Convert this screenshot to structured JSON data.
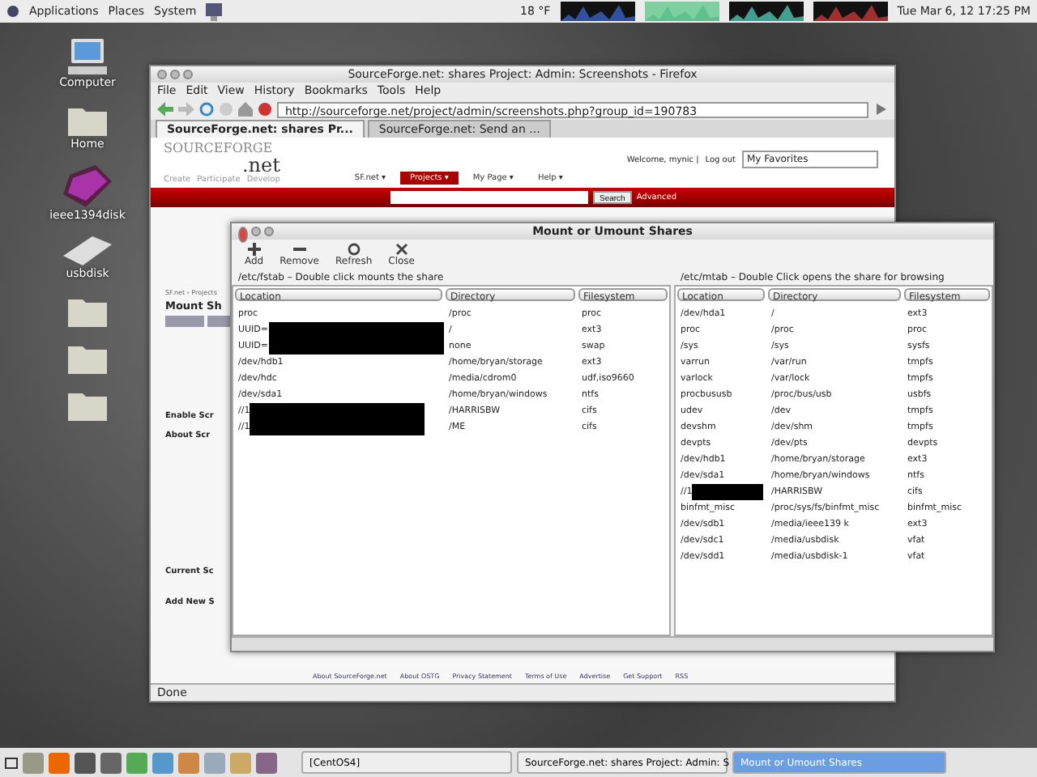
{
  "top_panel": {
    "menus": [
      "Applications",
      "Places",
      "System"
    ],
    "weather": "18 °F",
    "clock": "Tue Mar 6, 12 17:25 PM"
  },
  "desktop_icons": [
    {
      "label": "Computer",
      "kind": "computer"
    },
    {
      "label": "Home",
      "kind": "folder"
    },
    {
      "label": "ieee1394disk",
      "kind": "disk"
    },
    {
      "label": "usbdisk",
      "kind": "drive"
    },
    {
      "kind": "folder"
    },
    {
      "kind": "folder"
    },
    {
      "kind": "folder"
    }
  ],
  "browser": {
    "title": "SourceForge.net: shares Project: Admin: Screenshots - Firefox",
    "menus": [
      "File",
      "Edit",
      "View",
      "History",
      "Bookmarks",
      "Tools",
      "Help"
    ],
    "url": "http://sourceforge.net/project/admin/screenshots.php?group_id=190783",
    "tabs": [
      {
        "label": "SourceForge.net: shares Pr...",
        "selected": true
      },
      {
        "label": "SourceForge.net: Send an ...",
        "selected": false
      }
    ],
    "page": {
      "logo_top": "SOURCEFORGE",
      "logo_bottom": ".net",
      "sublinks": [
        "Create",
        "Participate",
        "Develop"
      ],
      "welcome": "Welcome, mynic |",
      "logout": "Log out",
      "favorites": "My Favorites",
      "nav": [
        {
          "label": "SF.net ▾",
          "selected": false
        },
        {
          "label": "Projects ▾",
          "selected": true
        },
        {
          "label": "My Page ▾",
          "selected": false
        },
        {
          "label": "Help ▾",
          "selected": false
        }
      ],
      "search_button": "Search",
      "advanced": "Advanced",
      "breadcrumb": "SF.net › Projects",
      "heading": "Mount Sh",
      "sections": [
        {
          "label": "Enable Scr"
        },
        {
          "label": "About Scr"
        },
        {
          "label": "Current Sc"
        },
        {
          "label": "Add New S"
        }
      ],
      "footer": [
        "About SourceForge.net",
        "About OSTG",
        "Privacy Statement",
        "Terms of Use",
        "Advertise",
        "Get Support",
        "RSS"
      ]
    },
    "status": "Done"
  },
  "dialog": {
    "title": "Mount or Umount Shares",
    "toolbar": [
      {
        "label": "Add",
        "kind": "add"
      },
      {
        "label": "Remove",
        "kind": "remove"
      },
      {
        "label": "Refresh",
        "kind": "refresh"
      },
      {
        "label": "Close",
        "kind": "close"
      }
    ],
    "panes": [
      {
        "caption": "/etc/fstab – Double click mounts the share",
        "columns": [
          "Location",
          "Directory",
          "Filesystem"
        ],
        "rows": [
          {
            "location": "proc",
            "redacted": false,
            "directory": "/proc",
            "filesystem": "proc"
          },
          {
            "location": "UUID=",
            "redacted": true,
            "directory": "/",
            "filesystem": "ext3"
          },
          {
            "location": "UUID=",
            "redacted": true,
            "directory": "none",
            "filesystem": "swap"
          },
          {
            "location": "/dev/hdb1",
            "redacted": false,
            "directory": "/home/bryan/storage",
            "filesystem": "ext3"
          },
          {
            "location": "/dev/hdc",
            "redacted": false,
            "directory": "/media/cdrom0",
            "filesystem": "udf,iso9660"
          },
          {
            "location": "/dev/sda1",
            "redacted": false,
            "directory": "/home/bryan/windows",
            "filesystem": "ntfs"
          },
          {
            "location": "//1",
            "redacted": true,
            "directory": "/HARRISBW",
            "filesystem": "cifs"
          },
          {
            "location": "//1",
            "redacted": true,
            "directory": "/ME",
            "filesystem": "cifs"
          }
        ]
      },
      {
        "caption": "/etc/mtab – Double Click opens the share for browsing",
        "columns": [
          "Location",
          "Directory",
          "Filesystem"
        ],
        "rows": [
          {
            "location": "/dev/hda1",
            "redacted": false,
            "directory": "/",
            "filesystem": "ext3"
          },
          {
            "location": "proc",
            "redacted": false,
            "directory": "/proc",
            "filesystem": "proc"
          },
          {
            "location": "/sys",
            "redacted": false,
            "directory": "/sys",
            "filesystem": "sysfs"
          },
          {
            "location": "varrun",
            "redacted": false,
            "directory": "/var/run",
            "filesystem": "tmpfs"
          },
          {
            "location": "varlock",
            "redacted": false,
            "directory": "/var/lock",
            "filesystem": "tmpfs"
          },
          {
            "location": "procbususb",
            "redacted": false,
            "directory": "/proc/bus/usb",
            "filesystem": "usbfs"
          },
          {
            "location": "udev",
            "redacted": false,
            "directory": "/dev",
            "filesystem": "tmpfs"
          },
          {
            "location": "devshm",
            "redacted": false,
            "directory": "/dev/shm",
            "filesystem": "tmpfs"
          },
          {
            "location": "devpts",
            "redacted": false,
            "directory": "/dev/pts",
            "filesystem": "devpts"
          },
          {
            "location": "/dev/hdb1",
            "redacted": false,
            "directory": "/home/bryan/storage",
            "filesystem": "ext3"
          },
          {
            "location": "/dev/sda1",
            "redacted": false,
            "directory": "/home/bryan/windows",
            "filesystem": "ntfs"
          },
          {
            "location": "//1",
            "redacted": true,
            "directory": "/HARRISBW",
            "filesystem": "cifs"
          },
          {
            "location": "binfmt_misc",
            "redacted": false,
            "directory": "/proc/sys/fs/binfmt_misc",
            "filesystem": "binfmt_misc"
          },
          {
            "location": "/dev/sdb1",
            "redacted": false,
            "directory": "/media/ieee139 k",
            "filesystem": "ext3"
          },
          {
            "location": "/dev/sdc1",
            "redacted": false,
            "directory": "/media/usbdisk",
            "filesystem": "vfat"
          },
          {
            "location": "/dev/sdd1",
            "redacted": false,
            "directory": "/media/usbdisk-1",
            "filesystem": "vfat"
          }
        ]
      }
    ]
  },
  "taskbar": {
    "tasks": [
      {
        "label": "[CentOS4]",
        "selected": false
      },
      {
        "label": "SourceForge.net: shares Project: Admin: S",
        "selected": false
      },
      {
        "label": "Mount or Umount Shares",
        "selected": true
      }
    ]
  }
}
